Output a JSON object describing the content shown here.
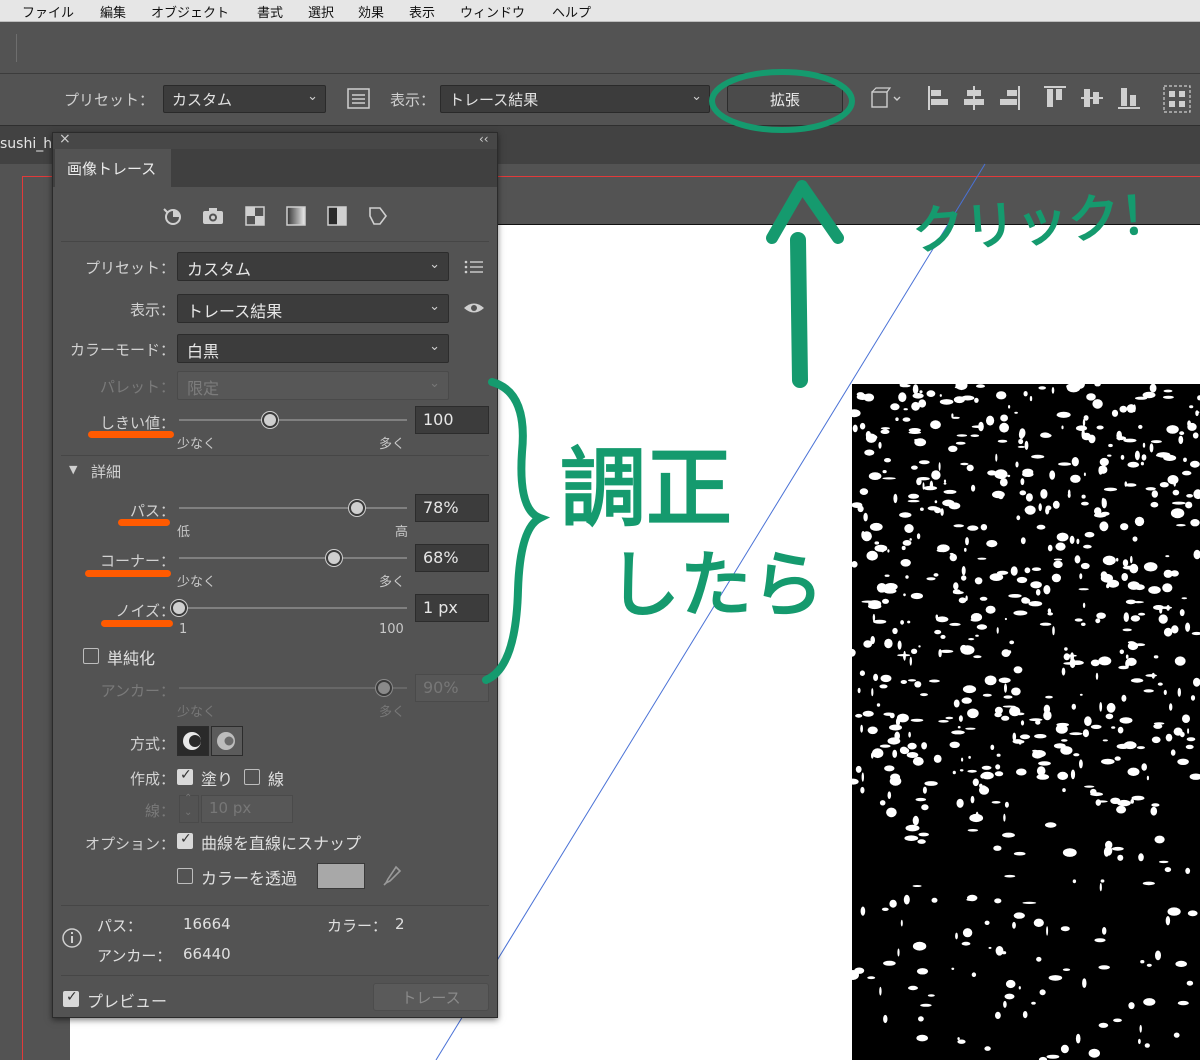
{
  "menu": {
    "items": [
      "ファイル",
      "編集",
      "オブジェクト",
      "書式",
      "選択",
      "効果",
      "表示",
      "ウィンドウ",
      "ヘルプ"
    ]
  },
  "controlbar": {
    "preset_label": "プリセット：",
    "preset_value": "カスタム",
    "view_label": "表示：",
    "view_value": "トレース結果",
    "expand_button": "拡張"
  },
  "document": {
    "tab_name": "sushi_h"
  },
  "panel": {
    "title": "画像トレース",
    "preset_label": "プリセット：",
    "preset_value": "カスタム",
    "view_label": "表示：",
    "view_value": "トレース結果",
    "color_mode_label": "カラーモード：",
    "color_mode_value": "白黒",
    "palette_label": "パレット：",
    "palette_value": "限定",
    "threshold": {
      "label": "しきい値：",
      "value": "100",
      "min_label": "少なく",
      "max_label": "多く",
      "level": 0.4
    },
    "advanced_label": "詳細",
    "paths": {
      "label": "パス：",
      "value": "78%",
      "min_label": "低",
      "max_label": "高",
      "level": 0.78
    },
    "corners": {
      "label": "コーナー：",
      "value": "68%",
      "min_label": "少なく",
      "max_label": "多く",
      "level": 0.68
    },
    "noise": {
      "label": "ノイズ：",
      "value": "1 px",
      "min_label": "1",
      "max_label": "100",
      "level": 0.0
    },
    "simplify_label": "単純化",
    "simplify_checked": false,
    "anchors": {
      "label": "アンカー：",
      "value": "90%",
      "min_label": "少なく",
      "max_label": "多く",
      "level": 0.9
    },
    "method_label": "方式：",
    "create_label": "作成：",
    "fill_label": "塗り",
    "fill_checked": true,
    "stroke_label": "線",
    "stroke_checked": false,
    "stroke_width_label": "線：",
    "stroke_width_value": "10 px",
    "options_label": "オプション：",
    "snap_label": "曲線を直線にスナップ",
    "snap_checked": true,
    "ignore_white_label": "カラーを透過",
    "ignore_white_checked": false,
    "stats": {
      "paths_label": "パス：",
      "paths_value": "16664",
      "colors_label": "カラー：",
      "colors_value": "2",
      "anchors_label": "アンカー：",
      "anchors_value": "66440"
    },
    "preview_label": "プレビュー",
    "preview_checked": true,
    "trace_button": "トレース"
  },
  "annotations": {
    "click_note": "クリック！",
    "adjust_note_line1": "調正",
    "adjust_note_line2": "したら",
    "color": "#159a6e",
    "underline_color": "#ff5a00"
  }
}
